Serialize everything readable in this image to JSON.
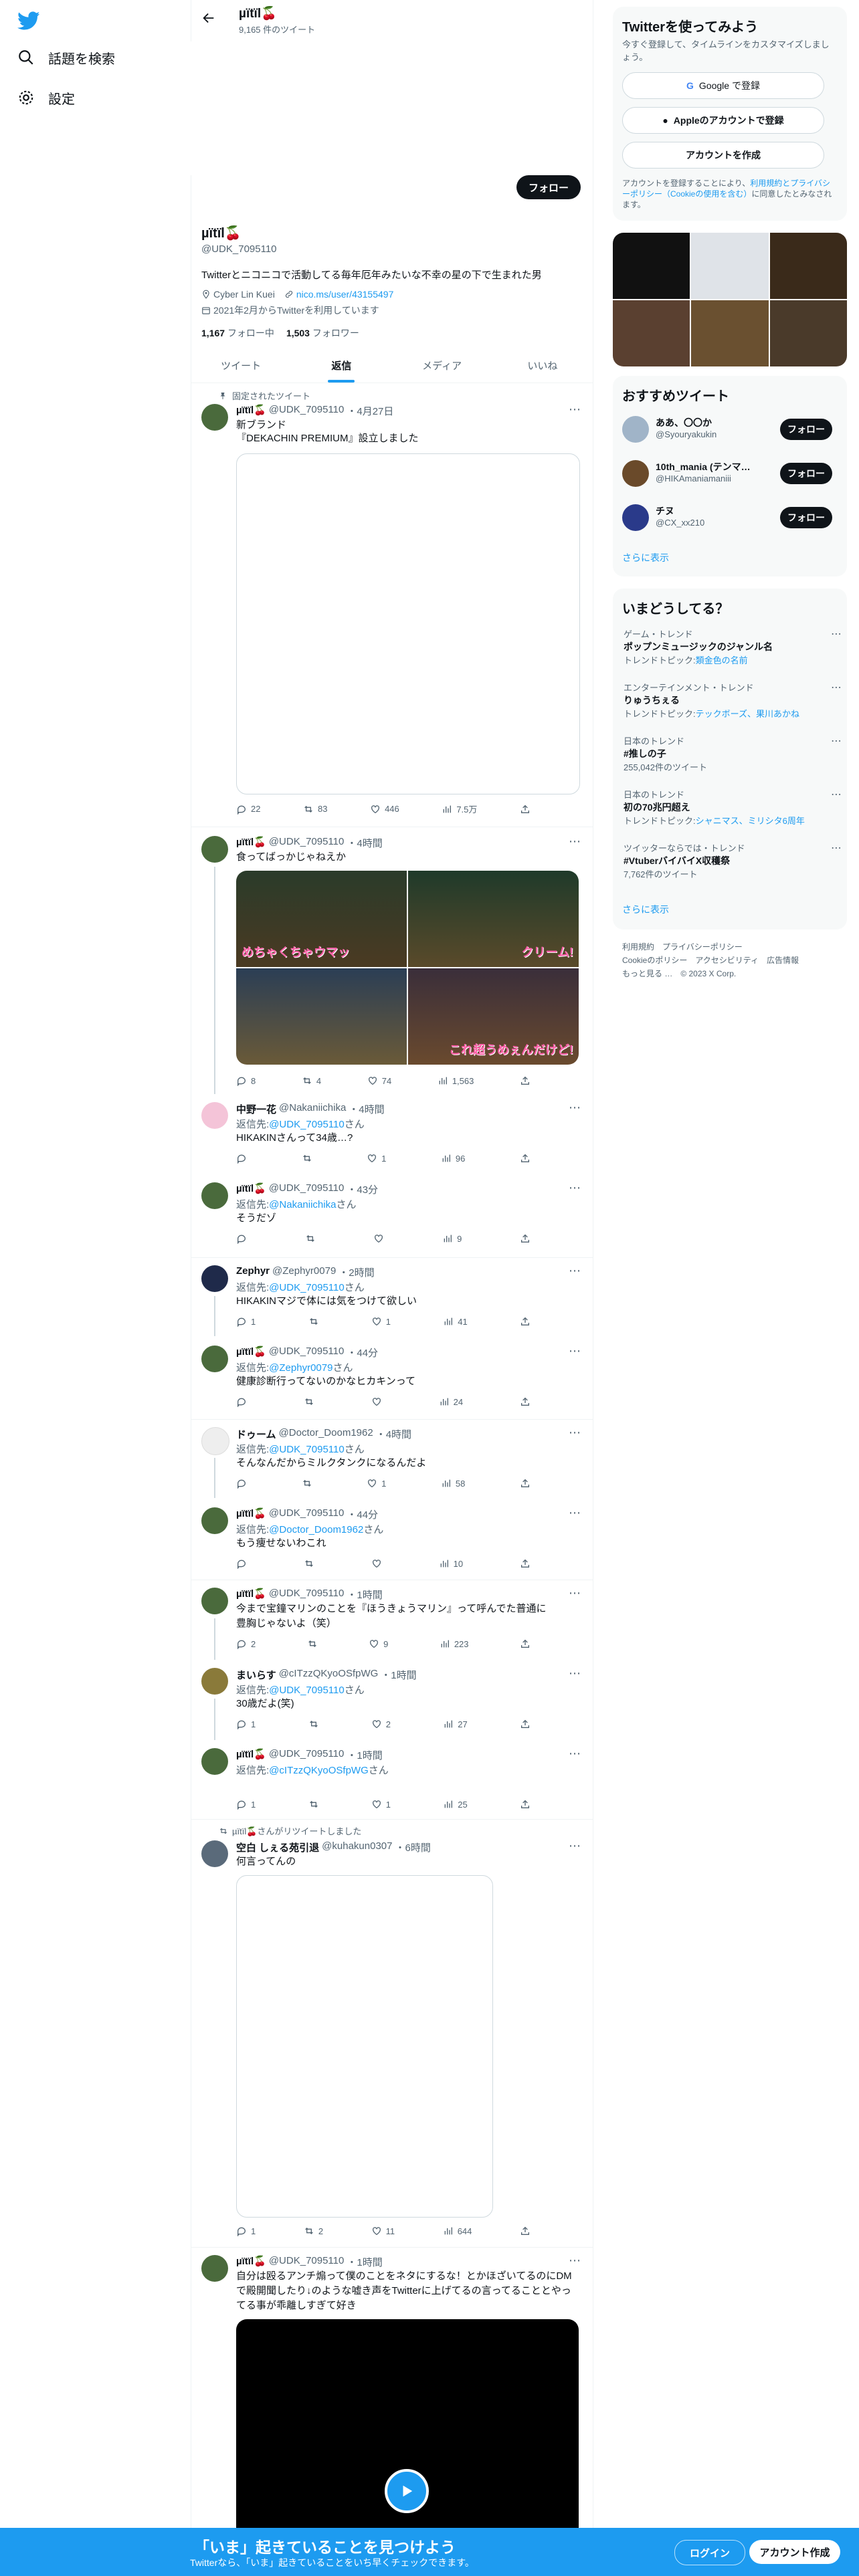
{
  "nav": {
    "items": [
      {
        "label": "話題を検索"
      },
      {
        "label": "設定"
      }
    ]
  },
  "header": {
    "name": "µïtïl🍒",
    "tweet_count": "9,165 件のツイート"
  },
  "profile": {
    "follow_label": "フォロー",
    "name": "µïtïl🍒",
    "handle": "@UDK_7095110",
    "bio": "Twitterとニコニコで活動してる毎年厄年みたいな不幸の星の下で生まれた男",
    "location": "Cyber Lin Kuei",
    "link": "nico.ms/user/43155497",
    "joined": "2021年2月からTwitterを利用しています",
    "following_count": "1,167",
    "following_label": "フォロー中",
    "followers_count": "1,503",
    "followers_label": "フォロワー"
  },
  "tabs": [
    "ツイート",
    "返信",
    "メディア",
    "いいね"
  ],
  "tweets": {
    "pinned": {
      "pinned_label": "固定されたツイート",
      "name": "µïtïl🍒",
      "handle": "@UDK_7095110",
      "time": "・4月27日",
      "text1": "新ブランド",
      "text2": "『DEKACHIN PREMIUM』設立しました",
      "reply": "22",
      "retweet": "83",
      "like": "446",
      "views": "7.5万"
    },
    "t2": {
      "name": "µïtïl🍒",
      "handle": "@UDK_7095110",
      "time": "・4時間",
      "text": "食ってばっかじゃねえか",
      "img_captions": [
        "めちゃくちゃウマッ",
        "クリーム!",
        "",
        "これ超うめぇんだけど!"
      ],
      "reply": "8",
      "retweet": "4",
      "like": "74",
      "views": "1,563"
    },
    "t3": {
      "name": "中野一花",
      "handle": "@Nakaniichika",
      "time": "・4時間",
      "reply_to_label": "返信先:",
      "reply_to": "@UDK_7095110",
      "reply_suffix": "さん",
      "text": "HIKAKINさんって34歳…?",
      "like": "1",
      "views": "96"
    },
    "t4": {
      "name": "µïtïl🍒",
      "handle": "@UDK_7095110",
      "time": "・43分",
      "reply_to_label": "返信先:",
      "reply_to": "@Nakaniichika",
      "reply_suffix": "さん",
      "text": "そうだゾ",
      "views": "9"
    },
    "t5": {
      "name": "Zephyr",
      "handle": "@Zephyr0079",
      "time": "・2時間",
      "reply_to_label": "返信先:",
      "reply_to": "@UDK_7095110",
      "reply_suffix": "さん",
      "text": "HIKAKINマジで体には気をつけて欲しい",
      "reply": "1",
      "like": "1",
      "views": "41"
    },
    "t6": {
      "name": "µïtïl🍒",
      "handle": "@UDK_7095110",
      "time": "・44分",
      "reply_to_label": "返信先:",
      "reply_to": "@Zephyr0079",
      "reply_suffix": "さん",
      "text": "健康診断行ってないのかなヒカキンって",
      "views": "24"
    },
    "t7": {
      "name": "ドゥーム",
      "handle": "@Doctor_Doom1962",
      "time": "・4時間",
      "reply_to_label": "返信先:",
      "reply_to": "@UDK_7095110",
      "reply_suffix": "さん",
      "text": "そんなんだからミルクタンクになるんだよ",
      "like": "1",
      "views": "58"
    },
    "t8": {
      "name": "µïtïl🍒",
      "handle": "@UDK_7095110",
      "time": "・44分",
      "reply_to_label": "返信先:",
      "reply_to": "@Doctor_Doom1962",
      "reply_suffix": "さん",
      "text": "もう痩せないわこれ",
      "views": "10"
    },
    "t9": {
      "name": "µïtïl🍒",
      "handle": "@UDK_7095110",
      "time": "・1時間",
      "text1": "今まで宝鐘マリンのことを『ほうきょうマリン』って呼んでた普通に",
      "text2": "豊胸じゃないよ（笑）",
      "reply": "2",
      "like": "9",
      "views": "223"
    },
    "t10": {
      "name": "まいらす",
      "handle": "@cITzzQKyoOSfpWG",
      "time": "・1時間",
      "reply_to_label": "返信先:",
      "reply_to": "@UDK_7095110",
      "reply_suffix": "さん",
      "text": "30歳だよ(笑)",
      "reply": "1",
      "like": "2",
      "views": "27"
    },
    "t11": {
      "name": "µïtïl🍒",
      "handle": "@UDK_7095110",
      "time": "・1時間",
      "reply_to_label": "返信先:",
      "reply_to": "@cITzzQKyoOSfpWG",
      "reply_suffix": "さん",
      "reply": "1",
      "like": "1",
      "views": "25"
    },
    "t12": {
      "retweeted_by": "µïtïl🍒さんがリツイートしました",
      "name": "空白 しぇる苑引退",
      "handle": "@kuhakun0307",
      "time": "・6時間",
      "text": "何言ってんの",
      "reply": "1",
      "retweet": "2",
      "like": "11",
      "views": "644"
    },
    "t13": {
      "name": "µïtïl🍒",
      "handle": "@UDK_7095110",
      "time": "・1時間",
      "text1": "自分は殴るアンチ煽って僕のことをネタにするな！とかほざいてるのにDM",
      "text2": "で殿開聞したり↓のような嘘き声をTwitterに上げてるの言ってることとやっ",
      "text3": "てる事が乖離しすぎて好き"
    }
  },
  "right": {
    "signup": {
      "title": "Twitterを使ってみよう",
      "subtitle": "今すぐ登録して、タイムラインをカスタマイズしましょう。",
      "google": "Google で登録",
      "apple": "Appleのアカウントで登録",
      "create": "アカウントを作成",
      "terms_prefix": "アカウントを登録することにより、",
      "terms_link": "利用規約とプライバシーポリシー（Cookieの使用を含む）",
      "terms_suffix": "に同意したとみなされます。"
    },
    "recommended": {
      "title": "おすすめツイート",
      "users": [
        {
          "name": "ああ、〇〇か",
          "handle": "@Syouryakukin",
          "btn": "フォロー"
        },
        {
          "name": "10th_mania (テンマ…",
          "handle": "@HIKAmaniamaniii",
          "btn": "フォロー"
        },
        {
          "name": "チヌ",
          "handle": "@CX_xx210",
          "btn": "フォロー"
        }
      ],
      "more": "さらに表示"
    },
    "trends": {
      "title": "いまどうしてる？",
      "items": [
        {
          "context": "ゲーム・トレンド",
          "name": "ポップンミュージックのジャンル名",
          "sub_label": "トレンドトピック:",
          "sub": "類金色の名前"
        },
        {
          "context": "エンターテインメント・トレンド",
          "name": "りゅうちぇる",
          "sub_label": "トレンドトピック:",
          "sub": "テックボーズ、果川あかね"
        },
        {
          "context": "日本のトレンド",
          "name": "#推しの子",
          "sub_label": "",
          "sub": "255,042件のツイート"
        },
        {
          "context": "日本のトレンド",
          "name": "初の70兆円超え",
          "sub_label": "トレンドトピック:",
          "sub": "シャニマス、ミリシタ6周年"
        },
        {
          "context": "ツイッターならでは・トレンド",
          "name": "#VtuberバイバイX収穫祭",
          "sub_label": "",
          "sub": "7,762件のツイート"
        }
      ],
      "more": "さらに表示"
    },
    "footer": {
      "line1": "利用規約　プライバシーポリシー",
      "line2": "Cookieのポリシー　アクセシビリティ　広告情報",
      "line3": "もっと見る …　© 2023 X Corp."
    }
  },
  "bottom": {
    "title": "「いま」起きていることを見つけよう",
    "subtitle": "Twitterなら、「いま」起きていることをいち早くチェックできます。",
    "login": "ログイン",
    "signup": "アカウント作成"
  },
  "colors": {
    "accent": "#1d9bf0",
    "dark": "#0f1419",
    "muted": "#536471"
  }
}
